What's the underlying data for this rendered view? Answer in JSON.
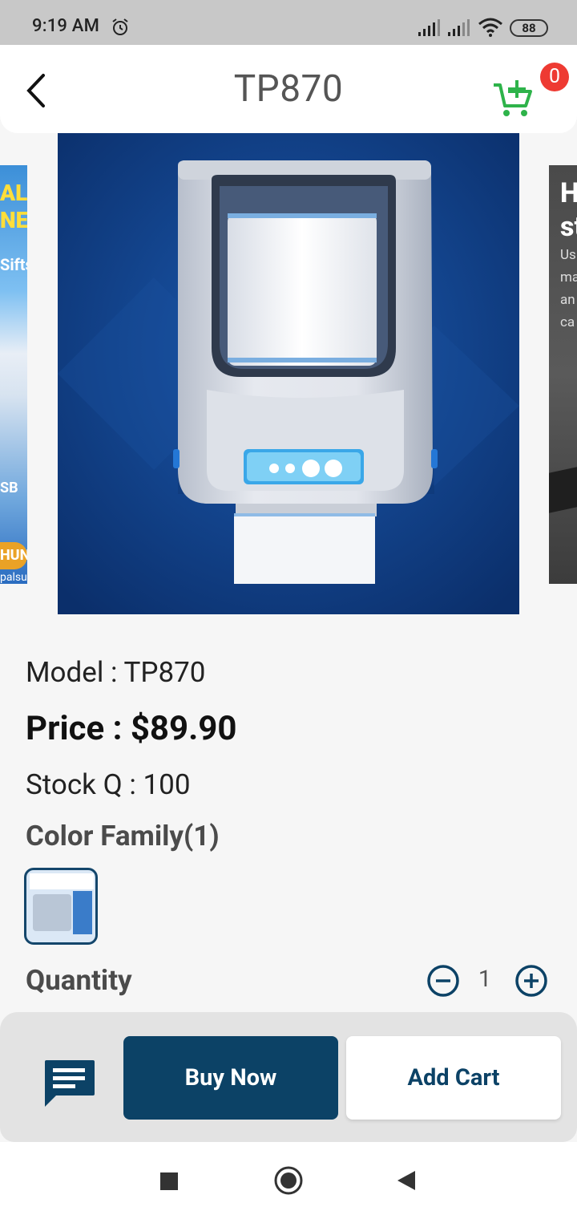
{
  "status_bar": {
    "time": "9:19 AM",
    "battery": "88",
    "icons": [
      "alarm-icon",
      "signal-icon",
      "signal-icon",
      "wifi-icon",
      "battery-icon"
    ]
  },
  "app_bar": {
    "title": "TP870",
    "back_icon": "chevron-left-icon",
    "cart_icon": "cart-plus-icon",
    "cart_count": "0"
  },
  "carousel": {
    "prev_slide_text": [
      "AL",
      "NE",
      "Sifts",
      "SB",
      "HUN",
      "palsu"
    ],
    "next_slide_text": [
      "H",
      "st",
      "Us",
      "ma",
      "an",
      "ca"
    ]
  },
  "product": {
    "model": "Model : TP870",
    "price": "Price : $89.90",
    "stock": "Stock Q : 100",
    "color_family_title": "Color Family(1)",
    "quantity_title": "Quantity",
    "quantity_value": "1"
  },
  "actions": {
    "chat_icon": "chat-icon",
    "buy_now": "Buy Now",
    "add_cart": "Add Cart"
  },
  "colors": {
    "primary": "#0c4266",
    "cart_green": "#2eb34a",
    "badge_red": "#ee3a32",
    "background": "#f6f6f6"
  }
}
